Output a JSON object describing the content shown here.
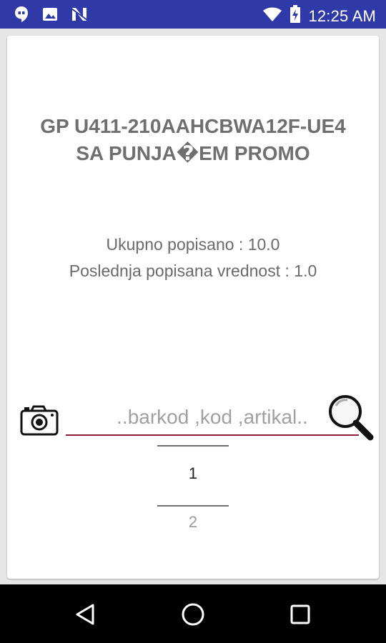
{
  "status_bar": {
    "time": "12:25 AM",
    "left_icons": [
      "hangouts-icon",
      "image-icon",
      "n-icon"
    ],
    "right_icons": [
      "wifi-icon",
      "battery-icon"
    ]
  },
  "product": {
    "title_line1": "GP U411-210AAHCBWA12F-UE4",
    "title_line2": "SA PUNJA�EM PROMO"
  },
  "info": {
    "total_label": "Ukupno popisano : 10.0",
    "last_label": "Poslednja popisana vrednost : 1.0"
  },
  "search": {
    "value": "",
    "placeholder": "..barkod ,kod ,artikal.."
  },
  "picker": {
    "selected": "1",
    "next": "2"
  },
  "colors": {
    "status_bar": "#2f3aa8",
    "accent_underline": "#8e1b3a",
    "title_text": "#6f6f6f"
  }
}
